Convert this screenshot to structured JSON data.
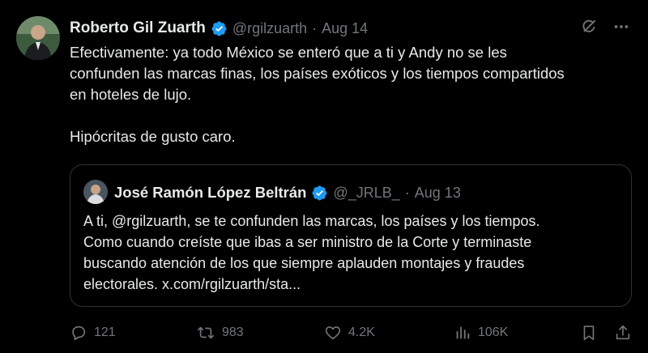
{
  "tweet": {
    "author_name": "Roberto Gil Zuarth",
    "author_handle": "@rgilzuarth",
    "separator": "·",
    "date": "Aug 14",
    "lines": [
      "Efectivamente: ya todo México se enteró que a ti y Andy no se les",
      "confunden las marcas finas, los países exóticos y los tiempos compartidos",
      "en hoteles de lujo."
    ],
    "closing_line": "Hipócritas de gusto caro."
  },
  "quoted": {
    "author_name": "José Ramón López Beltrán",
    "author_handle": "@_JRLB_",
    "separator": "·",
    "date": "Aug 13",
    "lines": [
      "A ti, @rgilzuarth, se te confunden las marcas, los países y los tiempos.",
      "Como cuando creíste que ibas a ser ministro de la Corte y terminaste",
      "buscando atención de los que siempre aplauden montajes y fraudes",
      "electorales. x.com/rgilzuarth/sta..."
    ]
  },
  "actions": {
    "replies": "121",
    "reposts": "983",
    "likes": "4.2K",
    "views": "106K"
  },
  "icons": {
    "verified": "verified-badge-icon",
    "grok": "grok-icon",
    "more": "more-icon",
    "reply": "reply-icon",
    "repost": "repost-icon",
    "like": "heart-icon",
    "views": "views-icon",
    "bookmark": "bookmark-icon",
    "share": "share-icon"
  },
  "colors": {
    "background": "#000000",
    "text": "#e7e9ea",
    "muted": "#71767b",
    "verified": "#1d9bf0",
    "border": "#2f3336"
  }
}
